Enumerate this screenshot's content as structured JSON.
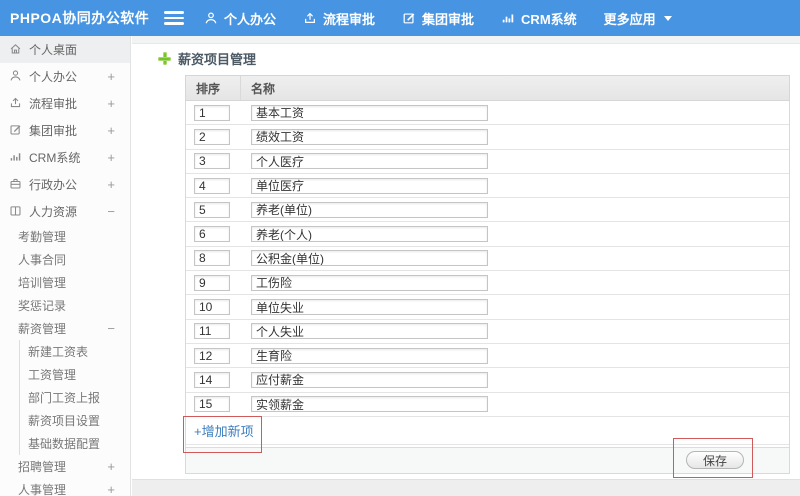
{
  "colors": {
    "navbar_blue": "#4795e2",
    "accent_green": "#76c327",
    "link_blue": "#3d7fc1",
    "annotation_red": "#d05a5a"
  },
  "navbar": {
    "logo": "PHPOA协同办公软件",
    "items": [
      {
        "label": "个人办公",
        "icon": "user-icon"
      },
      {
        "label": "流程审批",
        "icon": "process-icon"
      },
      {
        "label": "集团审批",
        "icon": "edit-icon"
      },
      {
        "label": "CRM系统",
        "icon": "chart-icon"
      },
      {
        "label": "更多应用",
        "icon": "caret-down-icon"
      }
    ]
  },
  "sidebar": {
    "items": [
      {
        "label": "个人桌面",
        "icon": "home-icon"
      },
      {
        "label": "个人办公",
        "icon": "user-icon",
        "expand": "+"
      },
      {
        "label": "流程审批",
        "icon": "process-icon",
        "expand": "+"
      },
      {
        "label": "集团审批",
        "icon": "edit-icon",
        "expand": "+"
      },
      {
        "label": "CRM系统",
        "icon": "chart-icon",
        "expand": "+"
      },
      {
        "label": "行政办公",
        "icon": "briefcase-icon",
        "expand": "+"
      },
      {
        "label": "人力资源",
        "icon": "book-icon",
        "expand": "−"
      },
      {
        "label": "考勤管理"
      },
      {
        "label": "人事合同"
      },
      {
        "label": "培训管理"
      },
      {
        "label": "奖惩记录"
      },
      {
        "label": "薪资管理",
        "expand": "−"
      },
      {
        "label": "新建工资表"
      },
      {
        "label": "工资管理"
      },
      {
        "label": "部门工资上报"
      },
      {
        "label": "薪资项目设置"
      },
      {
        "label": "基础数据配置"
      },
      {
        "label": "招聘管理",
        "expand": "+"
      },
      {
        "label": "人事管理",
        "expand": "+"
      }
    ]
  },
  "main": {
    "title": "薪资项目管理",
    "table": {
      "headers": [
        "排序",
        "名称"
      ],
      "rows": [
        {
          "order": "1",
          "name": "基本工资"
        },
        {
          "order": "2",
          "name": "绩效工资"
        },
        {
          "order": "3",
          "name": "个人医疗"
        },
        {
          "order": "4",
          "name": "单位医疗"
        },
        {
          "order": "5",
          "name": "养老(单位)"
        },
        {
          "order": "6",
          "name": "养老(个人)"
        },
        {
          "order": "8",
          "name": "公积金(单位)"
        },
        {
          "order": "9",
          "name": "工伤险"
        },
        {
          "order": "10",
          "name": "单位失业"
        },
        {
          "order": "11",
          "name": "个人失业"
        },
        {
          "order": "12",
          "name": "生育险"
        },
        {
          "order": "14",
          "name": "应付薪金"
        },
        {
          "order": "15",
          "name": "实领薪金"
        }
      ]
    },
    "add_link": "+增加新项",
    "save_button": "保存"
  }
}
